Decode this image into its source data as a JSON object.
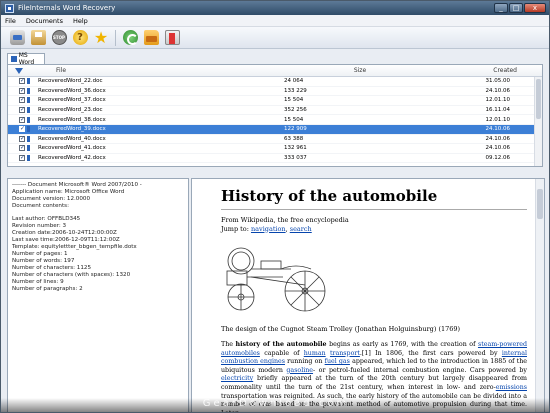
{
  "window": {
    "title": "FileInternals Word Recovery"
  },
  "menu": [
    "File",
    "Documents",
    "Help"
  ],
  "toolbar": {
    "buttons": [
      "open-icon",
      "save-icon",
      "stop-icon",
      "help-icon",
      "star-icon",
      "refresh-icon",
      "folder-icon",
      "exit-icon"
    ]
  },
  "tab": {
    "label": "MS Word"
  },
  "grid": {
    "columns": {
      "file": "File",
      "size": "Size",
      "created": "Created"
    },
    "rows": [
      {
        "file": "RecoveredWord_22.doc",
        "size": "24 064",
        "created": "31.05.00",
        "checked": true,
        "selected": false
      },
      {
        "file": "RecoveredWord_36.docx",
        "size": "133 229",
        "created": "24.10.06",
        "checked": true,
        "selected": false
      },
      {
        "file": "RecoveredWord_37.docx",
        "size": "15 504",
        "created": "12.01.10",
        "checked": true,
        "selected": false
      },
      {
        "file": "RecoveredWord_23.doc",
        "size": "352 256",
        "created": "16.11.04",
        "checked": true,
        "selected": false
      },
      {
        "file": "RecoveredWord_38.docx",
        "size": "15 504",
        "created": "12.01.10",
        "checked": true,
        "selected": false
      },
      {
        "file": "RecoveredWord_39.docx",
        "size": "122 909",
        "created": "24.10.06",
        "checked": true,
        "selected": true
      },
      {
        "file": "RecoveredWord_40.docx",
        "size": "63 388",
        "created": "24.10.06",
        "checked": true,
        "selected": false
      },
      {
        "file": "RecoveredWord_41.docx",
        "size": "132 961",
        "created": "24.10.06",
        "checked": true,
        "selected": false
      },
      {
        "file": "RecoveredWord_42.docx",
        "size": "333 037",
        "created": "09.12.06",
        "checked": true,
        "selected": false
      }
    ]
  },
  "properties": {
    "l1": "------- Document Microsoft® Word 2007/2010 -",
    "l2": "Application name: Microsoft Office Word",
    "l3": "Document version: 12.0000",
    "l4": "Document contents:",
    "l5": "Last author: OFFBLD345",
    "l6": "Revision number: 3",
    "l7": "Creation date:2006-10-24T12:00:00Z",
    "l8": "Last save time:2006-12-09T11:12:00Z",
    "l9": "Template: equitylettter_bbgen_tempfile.dotx",
    "l10": "Number of pages: 1",
    "l11": "Number of words: 197",
    "l12": "Number of characters: 1125",
    "l13": "Number of characters (with spaces): 1320",
    "l14": "Number of lines: 9",
    "l15": "Number of paragraphs: 2"
  },
  "preview": {
    "title": "History of the automobile",
    "from": "From Wikipedia, the free encyclopedia",
    "jump_prefix": "Jump to: ",
    "jump_nav": "navigation",
    "jump_sep": ", ",
    "jump_search": "search",
    "caption": "The design of the Cugnot Steam Trolley (Jonathan Holguinsburg) (1769)",
    "p1_a": "The ",
    "p1_bold": "history of the automobile",
    "p1_b": " begins as early as 1769, with the creation of ",
    "p1_link1": "steam-powered automobiles",
    "p1_c": " capable of ",
    "p1_link2": "human",
    "p1_sp": " ",
    "p1_link3": "transport",
    "p1_d": ".[1] In 1806, the first cars powered by ",
    "p1_link4": "internal combustion engines",
    "p1_e": " running on ",
    "p1_link5": "fuel gas",
    "p1_f": " appeared, which led to the introduction in 1885 of the ubiquitous modern ",
    "p1_link6": "gasoline",
    "p1_g": "- or petrol-fueled internal combustion engine. Cars powered by ",
    "p1_link7": "electricity",
    "p1_h": " briefly appeared at the turn of the 20th century but largely disappeared  from commonality until the turn of the 21st century, when interest in low- and zero-",
    "p1_link8": "emissions",
    "p1_i": " transportation was reignited. As such, the early history of the automobile can be divided into a number of eras based on the prevalent method of automotive propulsion during that time. Later"
  },
  "watermark": "GearDownload.com"
}
